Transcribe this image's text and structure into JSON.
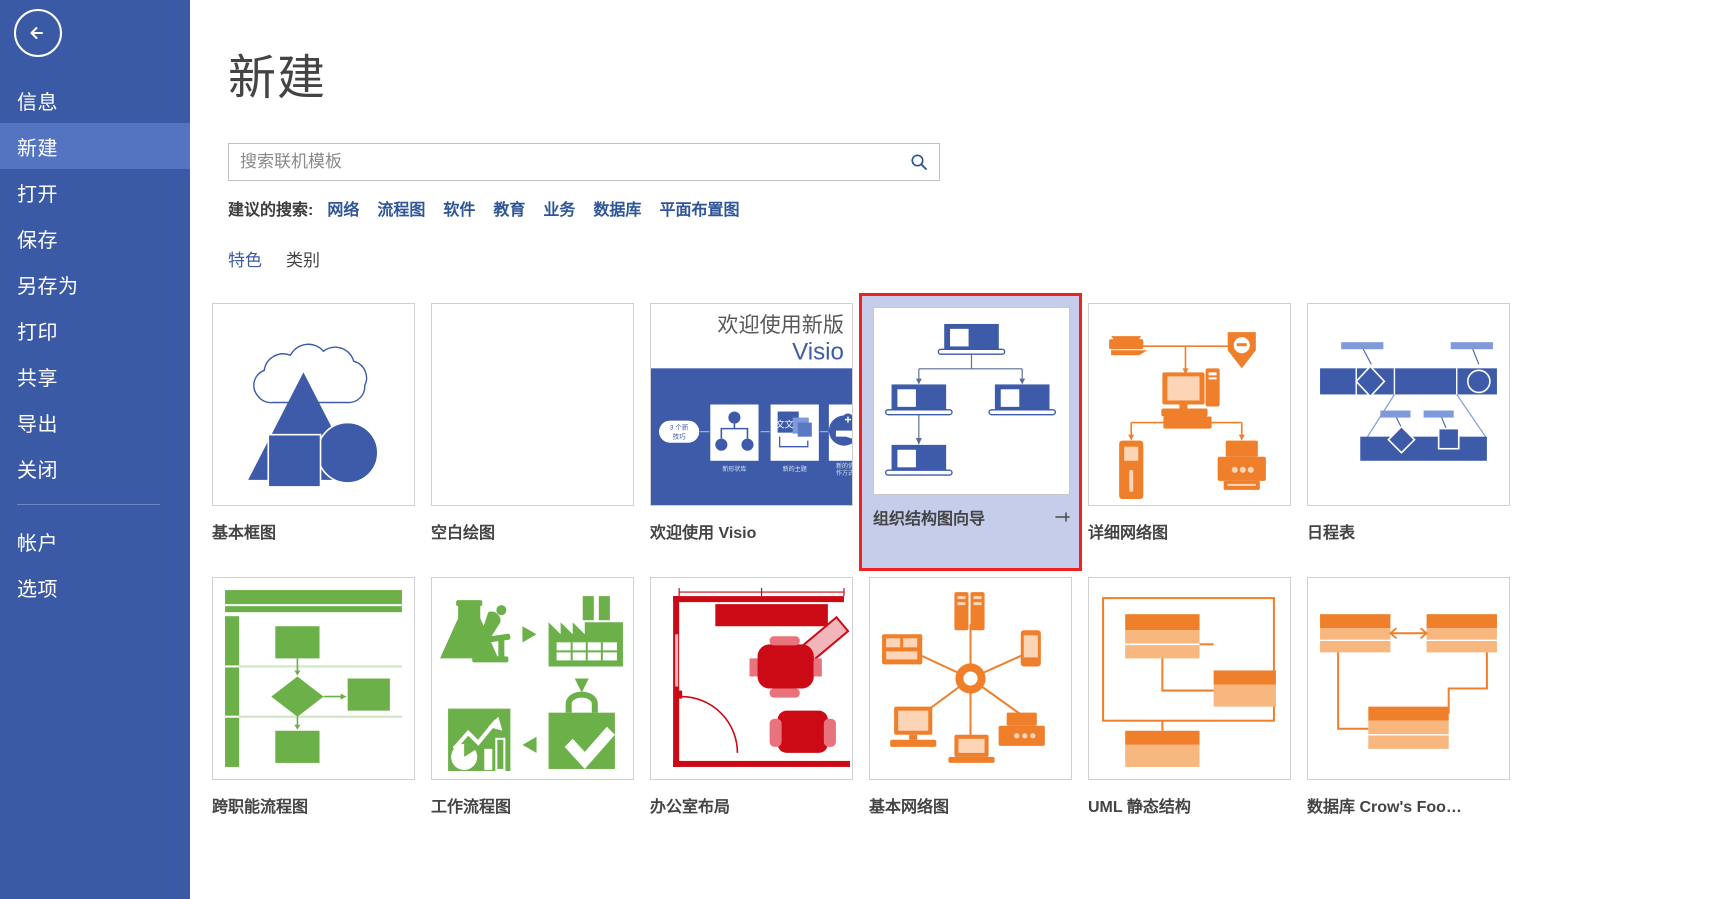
{
  "sidebar": {
    "back_icon": "back-arrow-icon",
    "items": [
      {
        "id": "info",
        "label": "信息",
        "active": false
      },
      {
        "id": "new",
        "label": "新建",
        "active": true
      },
      {
        "id": "open",
        "label": "打开",
        "active": false
      },
      {
        "id": "save",
        "label": "保存",
        "active": false
      },
      {
        "id": "saveas",
        "label": "另存为",
        "active": false
      },
      {
        "id": "print",
        "label": "打印",
        "active": false
      },
      {
        "id": "share",
        "label": "共享",
        "active": false
      },
      {
        "id": "export",
        "label": "导出",
        "active": false
      },
      {
        "id": "close",
        "label": "关闭",
        "active": false
      }
    ],
    "bottom_items": [
      {
        "id": "account",
        "label": "帐户"
      },
      {
        "id": "options",
        "label": "选项"
      }
    ]
  },
  "header": {
    "title": "新建"
  },
  "search": {
    "placeholder": "搜索联机模板",
    "value": "",
    "icon": "search-icon"
  },
  "suggested": {
    "label": "建议的搜索:",
    "links": [
      "网络",
      "流程图",
      "软件",
      "教育",
      "业务",
      "数据库",
      "平面布置图"
    ]
  },
  "tabs": [
    {
      "id": "featured",
      "label": "特色",
      "active": true
    },
    {
      "id": "categories",
      "label": "类别",
      "active": false
    }
  ],
  "templates": [
    {
      "id": "basic-diagram",
      "label": "基本框图",
      "thumb": "basic-diagram",
      "selected": false
    },
    {
      "id": "blank-drawing",
      "label": "空白绘图",
      "thumb": "blank",
      "selected": false
    },
    {
      "id": "welcome-visio",
      "label": "欢迎使用 Visio",
      "thumb": "welcome",
      "selected": false
    },
    {
      "id": "org-chart-wizard",
      "label": "组织结构图向导",
      "thumb": "org-chart",
      "selected": true,
      "pin_icon": "pin-icon"
    },
    {
      "id": "detailed-network",
      "label": "详细网络图",
      "thumb": "detailed-network",
      "selected": false
    },
    {
      "id": "timeline",
      "label": "日程表",
      "thumb": "timeline",
      "selected": false
    },
    {
      "id": "cross-functional",
      "label": "跨职能流程图",
      "thumb": "cross-functional",
      "selected": false
    },
    {
      "id": "work-flow",
      "label": "工作流程图",
      "thumb": "work-flow",
      "selected": false
    },
    {
      "id": "office-layout",
      "label": "办公室布局",
      "thumb": "office-layout",
      "selected": false
    },
    {
      "id": "basic-network",
      "label": "基本网络图",
      "thumb": "basic-network",
      "selected": false
    },
    {
      "id": "uml-static",
      "label": "UML 静态结构",
      "thumb": "uml-static",
      "selected": false
    },
    {
      "id": "crows-foot",
      "label": "数据库 Crow's Foo…",
      "thumb": "crows-foot",
      "selected": false
    }
  ],
  "welcome_thumb": {
    "title_line1": "欢迎使用新版",
    "title_line2": "Visio",
    "badge_line1": "3 个新",
    "badge_line2": "技巧",
    "caption1": "新形状库",
    "caption2": "新的主题",
    "caption3": "新的协作方式"
  },
  "colors": {
    "sidebar_bg": "#3b5aa6",
    "sidebar_active": "#5473c0",
    "accent_blue": "#3b5aa6",
    "thumb_blue": "#3d5ba9",
    "thumb_green": "#6cb04a",
    "thumb_orange": "#ef7f2a",
    "thumb_red": "#cc0a16",
    "selection_fill": "#c5cdeb",
    "selection_outline": "#ee2222",
    "link_blue": "#2f5597"
  }
}
